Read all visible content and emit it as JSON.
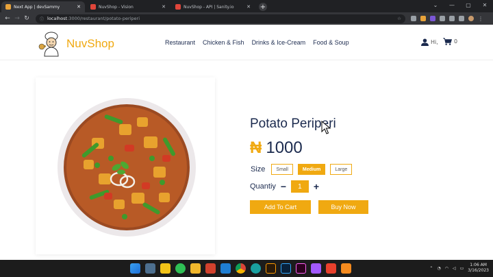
{
  "browser": {
    "tabs": [
      {
        "title": "Next App | devSammy",
        "active": true,
        "favicon_color": "#e8a33a"
      },
      {
        "title": "NuvShop - Vision",
        "active": false,
        "favicon_color": "#e0453a"
      },
      {
        "title": "NuvShop - API | Sanity.io",
        "active": false,
        "favicon_color": "#e0453a"
      }
    ],
    "new_tab": "+",
    "url_host": "localhost",
    "url_path": ":3000/restaurant/potato-periperi"
  },
  "header": {
    "brand": "NuvShop",
    "nav": [
      "Restaurant",
      "Chicken & Fish",
      "Drinks & Ice-Cream",
      "Food & Soup"
    ],
    "user_greeting": "Hi,",
    "cart_count": "0"
  },
  "product": {
    "name": "Potato Periperi",
    "currency_symbol": "₦",
    "price": "1000",
    "size_label": "Size",
    "sizes": [
      "Small",
      "Medium",
      "Large"
    ],
    "selected_size": "Medium",
    "quantity_label": "Quantiy",
    "quantity": "1",
    "minus": "−",
    "plus": "+",
    "add_to_cart": "Add To Cart",
    "buy_now": "Buy Now"
  },
  "taskbar": {
    "time": "1:06 AM",
    "date": "3/16/2023"
  },
  "colors": {
    "accent": "#f0a911",
    "text": "#1b2a4e"
  }
}
